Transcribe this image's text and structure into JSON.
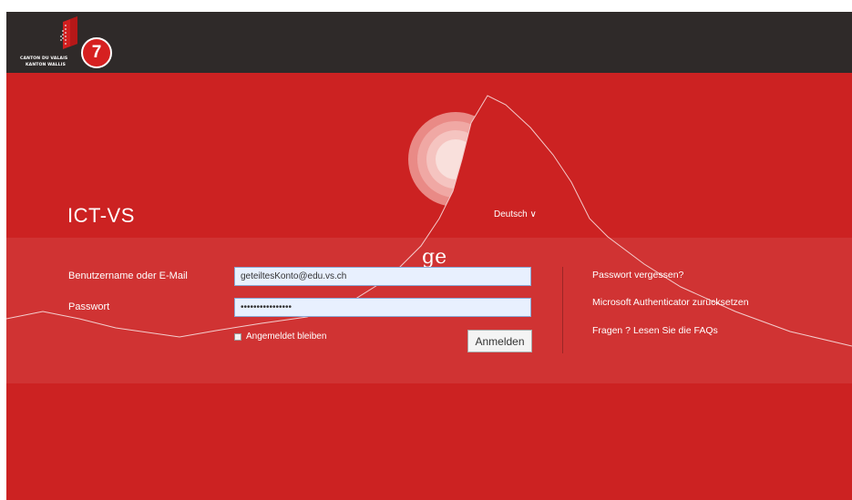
{
  "header": {
    "logo_line1": "CANTON DU VALAIS",
    "logo_line2": "KANTON WALLIS",
    "step_badge": "7"
  },
  "site_title": "ICT-VS",
  "language_selector": "Deutsch ∨",
  "overlay_text": "ge",
  "form": {
    "username_label": "Benutzername oder E-Mail",
    "username_value": "geteiltesKonto@edu.vs.ch",
    "password_label": "Passwort",
    "password_value": "••••••••••••••••",
    "remember_label": "Angemeldet bleiben",
    "login_button": "Anmelden"
  },
  "links": {
    "forgot_password": "Passwort vergessen?",
    "reset_authenticator": "Microsoft Authenticator zurücksetzen",
    "faq": "Fragen ? Lesen Sie die FAQs"
  },
  "colors": {
    "brand_red": "#cc2222",
    "top_bar": "#2f2a29",
    "input_bg": "#e8f0fe"
  }
}
